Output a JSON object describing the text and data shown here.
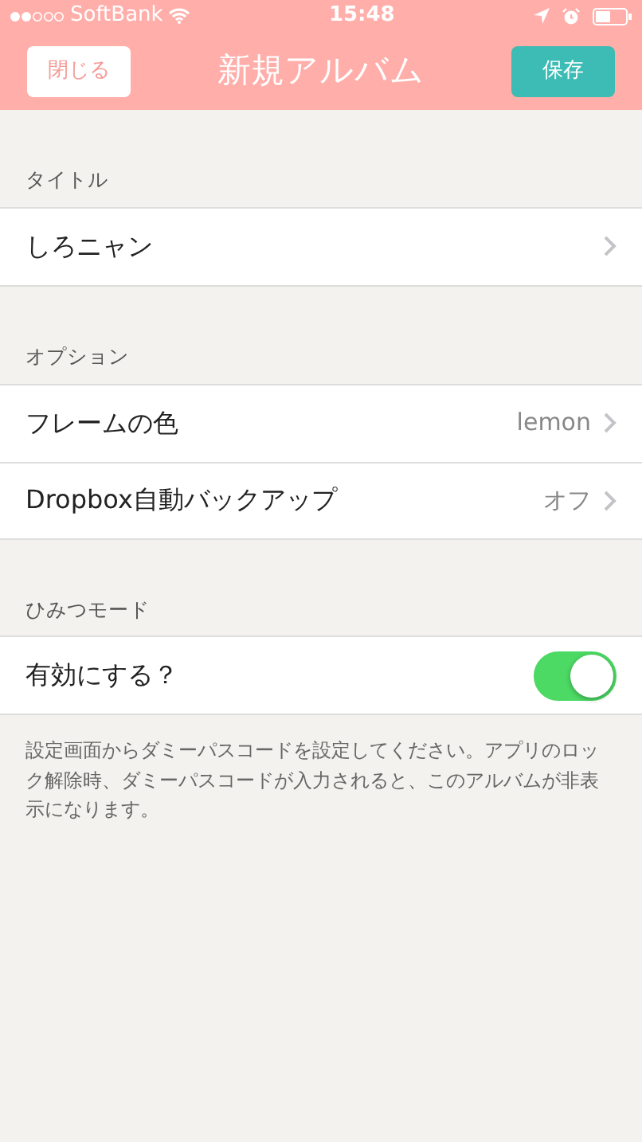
{
  "status_bar": {
    "carrier": "SoftBank",
    "time": "15:48"
  },
  "nav": {
    "title": "新規アルバム",
    "left_button": "閉じる",
    "right_button": "保存"
  },
  "sections": [
    {
      "header": "タイトル",
      "rows": [
        {
          "kind": "link",
          "label": "しろニャン"
        }
      ]
    },
    {
      "header": "オプション",
      "rows": [
        {
          "kind": "link",
          "label": "フレームの色",
          "value": "lemon"
        },
        {
          "kind": "link",
          "label": "Dropbox自動バックアップ",
          "value": "オフ"
        }
      ]
    },
    {
      "header": "ひみつモード",
      "rows": [
        {
          "kind": "toggle",
          "label": "有効にする？",
          "on": true
        }
      ],
      "footer": "設定画面からダミーパスコードを設定してください。アプリのロック解除時、ダミーパスコードが入力されると、このアルバムが非表示になります。"
    }
  ]
}
